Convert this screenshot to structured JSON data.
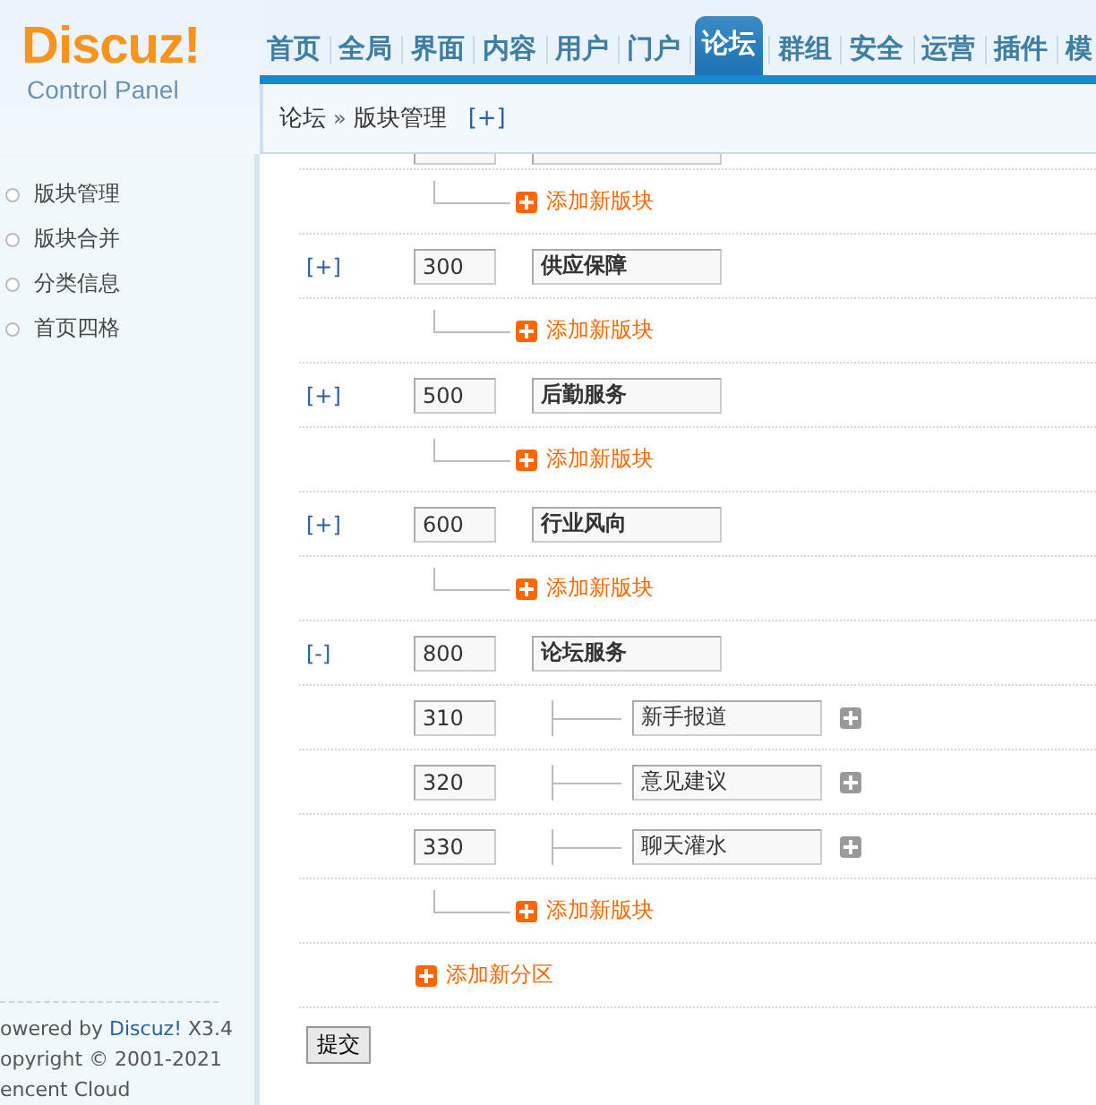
{
  "logo": {
    "title": "Discuz!",
    "subtitle": "Control Panel"
  },
  "nav": [
    {
      "label": "首页",
      "selected": false
    },
    {
      "label": "全局",
      "selected": false
    },
    {
      "label": "界面",
      "selected": false
    },
    {
      "label": "内容",
      "selected": false
    },
    {
      "label": "用户",
      "selected": false
    },
    {
      "label": "门户",
      "selected": false
    },
    {
      "label": "论坛",
      "selected": true
    },
    {
      "label": "群组",
      "selected": false
    },
    {
      "label": "安全",
      "selected": false
    },
    {
      "label": "运营",
      "selected": false
    },
    {
      "label": "插件",
      "selected": false
    },
    {
      "label": "模",
      "selected": false
    }
  ],
  "breadcrumb": {
    "items": [
      "论坛",
      "版块管理"
    ],
    "separator": "»",
    "toggle": "[+]"
  },
  "sidebar": {
    "items": [
      {
        "label": "版块管理"
      },
      {
        "label": "版块合并"
      },
      {
        "label": "分类信息"
      },
      {
        "label": "首页四格"
      }
    ],
    "footer": {
      "powered_prefix": "owered by ",
      "powered_link": "Discuz!",
      "powered_suffix": " X3.4",
      "copyright": "opyright © 2001-2021",
      "company": "encent Cloud"
    }
  },
  "rows": [
    {
      "kind": "add-board",
      "label": "添加新版块"
    },
    {
      "kind": "category",
      "toggle": "[+]",
      "order": "300",
      "name": "供应保障"
    },
    {
      "kind": "add-board",
      "label": "添加新版块"
    },
    {
      "kind": "category",
      "toggle": "[+]",
      "order": "500",
      "name": "后勤服务"
    },
    {
      "kind": "add-board",
      "label": "添加新版块"
    },
    {
      "kind": "category",
      "toggle": "[+]",
      "order": "600",
      "name": "行业风向"
    },
    {
      "kind": "add-board",
      "label": "添加新版块"
    },
    {
      "kind": "category",
      "toggle": "[-]",
      "order": "800",
      "name": "论坛服务"
    },
    {
      "kind": "board",
      "order": "310",
      "name": "新手报道"
    },
    {
      "kind": "board",
      "order": "320",
      "name": "意见建议"
    },
    {
      "kind": "board",
      "order": "330",
      "name": "聊天灌水"
    },
    {
      "kind": "add-board",
      "label": "添加新版块"
    },
    {
      "kind": "add-section",
      "label": "添加新分区"
    }
  ],
  "submit": "提交"
}
